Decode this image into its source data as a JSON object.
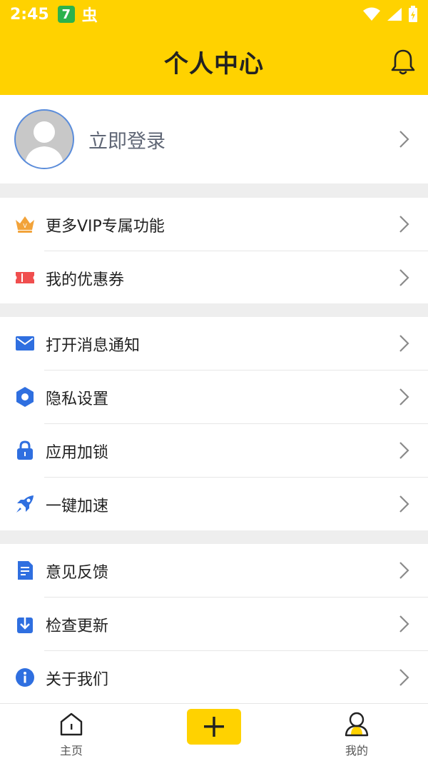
{
  "status_bar": {
    "time": "2:45",
    "app_badge": "7",
    "bug_glyph": "虫"
  },
  "header": {
    "title": "个人中心"
  },
  "profile": {
    "login_label": "立即登录"
  },
  "sections": [
    {
      "items": [
        {
          "label": "更多VIP专属功能",
          "icon": "crown-icon",
          "color": "#F2A33A"
        },
        {
          "label": "我的优惠券",
          "icon": "coupon-icon",
          "color": "#F04E4E"
        }
      ]
    },
    {
      "items": [
        {
          "label": "打开消息通知",
          "icon": "mail-icon",
          "color": "#2F6FE0"
        },
        {
          "label": "隐私设置",
          "icon": "gear-icon",
          "color": "#2F6FE0"
        },
        {
          "label": "应用加锁",
          "icon": "lock-icon",
          "color": "#2F6FE0"
        },
        {
          "label": "一键加速",
          "icon": "rocket-icon",
          "color": "#2F6FE0"
        }
      ]
    },
    {
      "items": [
        {
          "label": "意见反馈",
          "icon": "feedback-icon",
          "color": "#2F6FE0"
        },
        {
          "label": "检查更新",
          "icon": "update-icon",
          "color": "#2F6FE0"
        },
        {
          "label": "关于我们",
          "icon": "info-icon",
          "color": "#2F6FE0"
        }
      ]
    }
  ],
  "bottom_nav": {
    "home_label": "主页",
    "mine_label": "我的"
  },
  "colors": {
    "brand_yellow": "#FFD200",
    "icon_blue": "#2F6FE0"
  }
}
